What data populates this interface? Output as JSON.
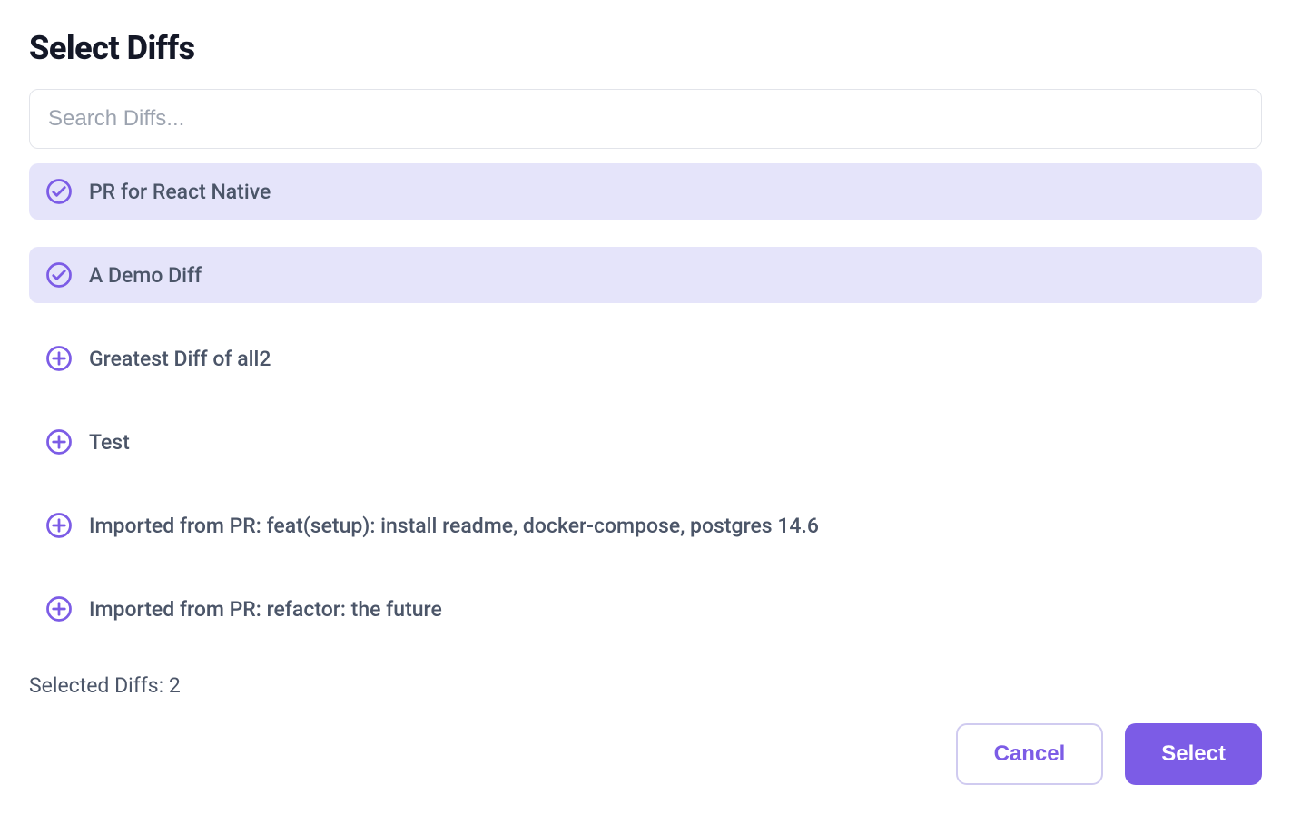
{
  "title": "Select Diffs",
  "search": {
    "placeholder": "Search Diffs..."
  },
  "diffs": [
    {
      "label": "PR for React Native",
      "selected": true
    },
    {
      "label": "A Demo Diff",
      "selected": true
    },
    {
      "label": "Greatest Diff of all2",
      "selected": false
    },
    {
      "label": "Test",
      "selected": false
    },
    {
      "label": "Imported from PR: feat(setup): install readme, docker-compose, postgres 14.6",
      "selected": false
    },
    {
      "label": "Imported from PR: refactor: the future",
      "selected": false
    }
  ],
  "selected_count_label": "Selected Diffs: 2",
  "buttons": {
    "cancel": "Cancel",
    "select": "Select"
  },
  "colors": {
    "accent": "#7c5ce6",
    "selected_bg": "#e5e4fa",
    "title_text": "#141827",
    "body_text": "#4b5568"
  }
}
